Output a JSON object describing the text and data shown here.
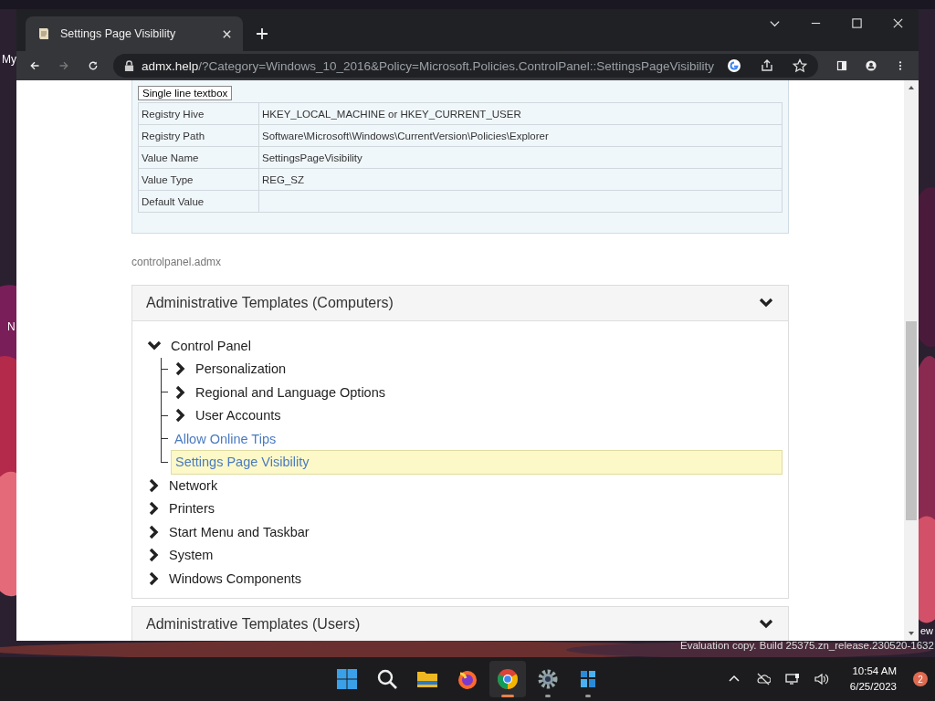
{
  "desktop": {
    "icon_labels": [
      "My",
      "N",
      "ew"
    ],
    "watermark": "Evaluation copy. Build 25375.zn_release.230520-1632"
  },
  "browser": {
    "tabs": [
      {
        "title": "Settings Page Visibility",
        "selected": true
      }
    ],
    "address": {
      "host": "admx.help",
      "path": "/?Category=Windows_10_2016&Policy=Microsoft.Policies.ControlPanel::SettingsPageVisibility"
    }
  },
  "page": {
    "element_button": "Single line textbox",
    "registry_table": [
      {
        "label": "Registry Hive",
        "value": "HKEY_LOCAL_MACHINE or HKEY_CURRENT_USER"
      },
      {
        "label": "Registry Path",
        "value": "Software\\Microsoft\\Windows\\CurrentVersion\\Policies\\Explorer"
      },
      {
        "label": "Value Name",
        "value": "SettingsPageVisibility"
      },
      {
        "label": "Value Type",
        "value": "REG_SZ"
      },
      {
        "label": "Default Value"
      }
    ],
    "file_name": "controlpanel.admx",
    "sections": [
      {
        "title": "Administrative Templates (Computers)",
        "expanded": true,
        "tree": [
          {
            "label": "Control Panel",
            "kind": "category",
            "expanded": true,
            "children": [
              {
                "label": "Personalization",
                "kind": "category",
                "expanded": false
              },
              {
                "label": "Regional and Language Options",
                "kind": "category",
                "expanded": false
              },
              {
                "label": "User Accounts",
                "kind": "category",
                "expanded": false
              },
              {
                "label": "Allow Online Tips",
                "kind": "policy",
                "selected": false
              },
              {
                "label": "Settings Page Visibility",
                "kind": "policy",
                "selected": true
              }
            ]
          },
          {
            "label": "Network",
            "kind": "category",
            "expanded": false
          },
          {
            "label": "Printers",
            "kind": "category",
            "expanded": false
          },
          {
            "label": "Start Menu and Taskbar",
            "kind": "category",
            "expanded": false
          },
          {
            "label": "System",
            "kind": "category",
            "expanded": false
          },
          {
            "label": "Windows Components",
            "kind": "category",
            "expanded": false
          }
        ]
      },
      {
        "title": "Administrative Templates (Users)",
        "expanded": false
      }
    ]
  },
  "taskbar": {
    "apps": [
      {
        "kind": "start",
        "running": false,
        "selected": false
      },
      {
        "kind": "search",
        "running": false,
        "selected": false
      },
      {
        "kind": "files",
        "running": false,
        "selected": false
      },
      {
        "kind": "firefox",
        "running": false,
        "selected": false
      },
      {
        "kind": "chrome",
        "running": true,
        "selected": true
      },
      {
        "kind": "settings",
        "running": true,
        "selected": false
      },
      {
        "kind": "cubes",
        "running": true,
        "selected": false
      }
    ],
    "time": "10:54 AM",
    "date": "6/25/2023",
    "notification_count": "2"
  }
}
